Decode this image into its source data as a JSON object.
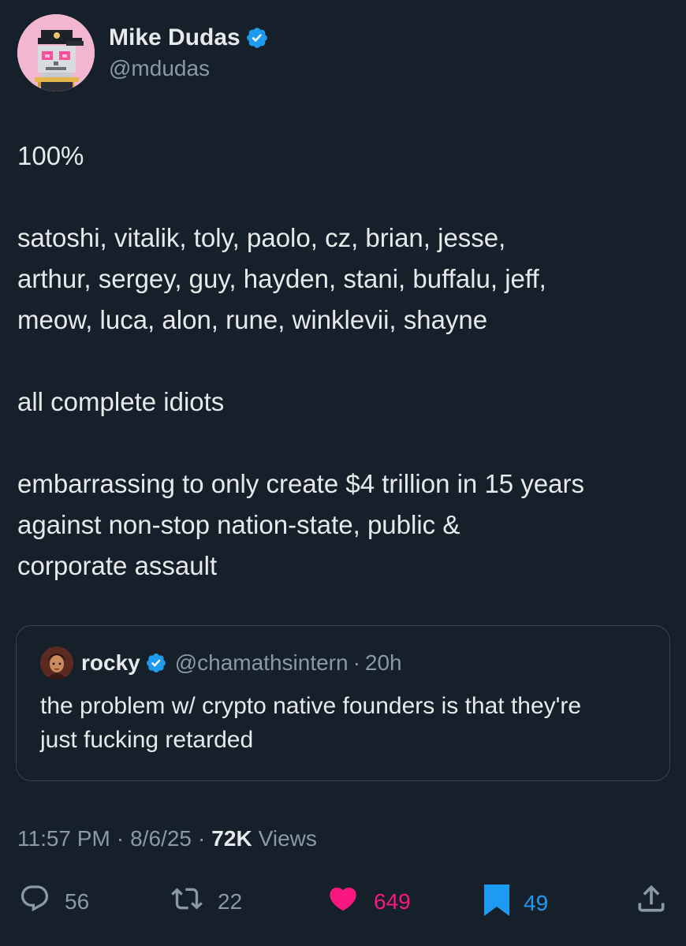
{
  "author": {
    "name": "Mike Dudas",
    "handle": "@mdudas",
    "avatar_icon": "pixel-skull-avatar",
    "verified_color": "#1d9bf0"
  },
  "tweet": {
    "paragraphs": [
      "100%",
      "satoshi, vitalik, toly, paolo, cz, brian, jesse,\narthur, sergey, guy, hayden, stani, buffalu, jeff,\nmeow, luca, alon, rune, winklevii, shayne",
      "all complete idiots",
      "embarrassing to only create $4 trillion in 15 years\nagainst non-stop nation-state, public &\ncorporate assault"
    ]
  },
  "quote": {
    "name": "rocky",
    "handle": "@chamathsintern",
    "dot": "·",
    "time": "20h",
    "text": "the problem w/ crypto native founders is that they're just fucking retarded"
  },
  "meta": {
    "time": "11:57 PM",
    "sep1": "·",
    "date": "8/6/25",
    "sep2": "·",
    "views_count": "72K",
    "views_label": "Views"
  },
  "actions": {
    "replies": "56",
    "reposts": "22",
    "likes": "649",
    "bookmarks": "49",
    "like_color": "#f91880",
    "bookmark_color": "#1d9bf0",
    "default_color": "#8b98a5"
  }
}
